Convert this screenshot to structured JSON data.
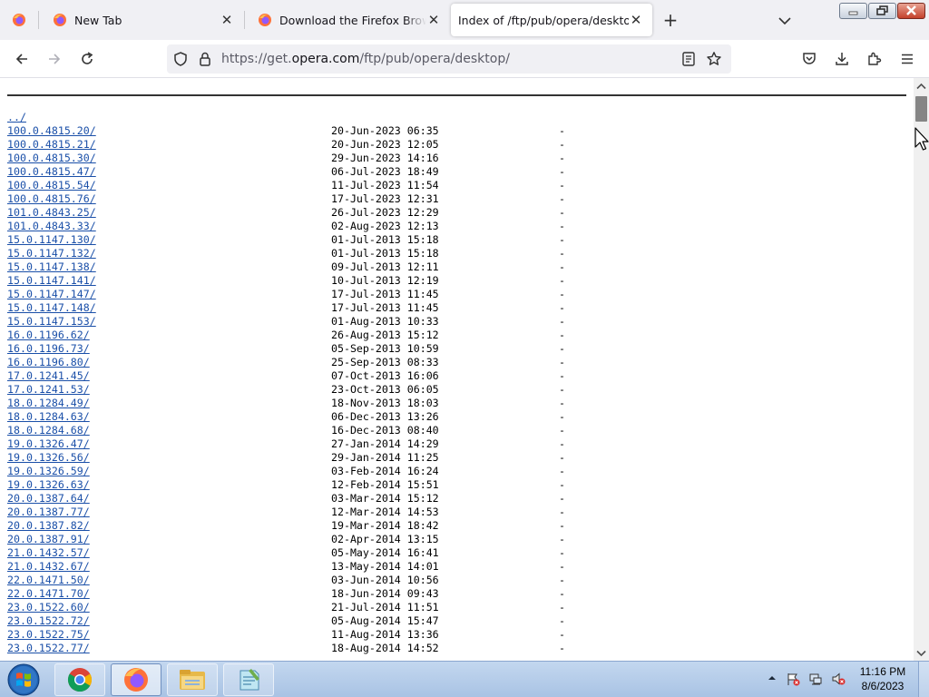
{
  "browser": {
    "tabs": [
      {
        "title": "New Tab",
        "active": false
      },
      {
        "title": "Download the Firefox Browser in English",
        "active": false
      },
      {
        "title": "Index of /ftp/pub/opera/desktop/",
        "active": true
      }
    ],
    "url": {
      "scheme": "https://get.",
      "host": "opera.com",
      "path": "/ftp/pub/opera/desktop/"
    }
  },
  "listing": {
    "parent": "../",
    "entries": [
      {
        "name": "100.0.4815.20/",
        "date": "20-Jun-2023 06:35",
        "size": "-"
      },
      {
        "name": "100.0.4815.21/",
        "date": "20-Jun-2023 12:05",
        "size": "-"
      },
      {
        "name": "100.0.4815.30/",
        "date": "29-Jun-2023 14:16",
        "size": "-"
      },
      {
        "name": "100.0.4815.47/",
        "date": "06-Jul-2023 18:49",
        "size": "-"
      },
      {
        "name": "100.0.4815.54/",
        "date": "11-Jul-2023 11:54",
        "size": "-"
      },
      {
        "name": "100.0.4815.76/",
        "date": "17-Jul-2023 12:31",
        "size": "-"
      },
      {
        "name": "101.0.4843.25/",
        "date": "26-Jul-2023 12:29",
        "size": "-"
      },
      {
        "name": "101.0.4843.33/",
        "date": "02-Aug-2023 12:13",
        "size": "-"
      },
      {
        "name": "15.0.1147.130/",
        "date": "01-Jul-2013 15:18",
        "size": "-"
      },
      {
        "name": "15.0.1147.132/",
        "date": "01-Jul-2013 15:18",
        "size": "-"
      },
      {
        "name": "15.0.1147.138/",
        "date": "09-Jul-2013 12:11",
        "size": "-"
      },
      {
        "name": "15.0.1147.141/",
        "date": "10-Jul-2013 12:19",
        "size": "-"
      },
      {
        "name": "15.0.1147.147/",
        "date": "17-Jul-2013 11:45",
        "size": "-"
      },
      {
        "name": "15.0.1147.148/",
        "date": "17-Jul-2013 11:45",
        "size": "-"
      },
      {
        "name": "15.0.1147.153/",
        "date": "01-Aug-2013 10:33",
        "size": "-"
      },
      {
        "name": "16.0.1196.62/",
        "date": "26-Aug-2013 15:12",
        "size": "-"
      },
      {
        "name": "16.0.1196.73/",
        "date": "05-Sep-2013 10:59",
        "size": "-"
      },
      {
        "name": "16.0.1196.80/",
        "date": "25-Sep-2013 08:33",
        "size": "-"
      },
      {
        "name": "17.0.1241.45/",
        "date": "07-Oct-2013 16:06",
        "size": "-"
      },
      {
        "name": "17.0.1241.53/",
        "date": "23-Oct-2013 06:05",
        "size": "-"
      },
      {
        "name": "18.0.1284.49/",
        "date": "18-Nov-2013 18:03",
        "size": "-"
      },
      {
        "name": "18.0.1284.63/",
        "date": "06-Dec-2013 13:26",
        "size": "-"
      },
      {
        "name": "18.0.1284.68/",
        "date": "16-Dec-2013 08:40",
        "size": "-"
      },
      {
        "name": "19.0.1326.47/",
        "date": "27-Jan-2014 14:29",
        "size": "-"
      },
      {
        "name": "19.0.1326.56/",
        "date": "29-Jan-2014 11:25",
        "size": "-"
      },
      {
        "name": "19.0.1326.59/",
        "date": "03-Feb-2014 16:24",
        "size": "-"
      },
      {
        "name": "19.0.1326.63/",
        "date": "12-Feb-2014 15:51",
        "size": "-"
      },
      {
        "name": "20.0.1387.64/",
        "date": "03-Mar-2014 15:12",
        "size": "-"
      },
      {
        "name": "20.0.1387.77/",
        "date": "12-Mar-2014 14:53",
        "size": "-"
      },
      {
        "name": "20.0.1387.82/",
        "date": "19-Mar-2014 18:42",
        "size": "-"
      },
      {
        "name": "20.0.1387.91/",
        "date": "02-Apr-2014 13:15",
        "size": "-"
      },
      {
        "name": "21.0.1432.57/",
        "date": "05-May-2014 16:41",
        "size": "-"
      },
      {
        "name": "21.0.1432.67/",
        "date": "13-May-2014 14:01",
        "size": "-"
      },
      {
        "name": "22.0.1471.50/",
        "date": "03-Jun-2014 10:56",
        "size": "-"
      },
      {
        "name": "22.0.1471.70/",
        "date": "18-Jun-2014 09:43",
        "size": "-"
      },
      {
        "name": "23.0.1522.60/",
        "date": "21-Jul-2014 11:51",
        "size": "-"
      },
      {
        "name": "23.0.1522.72/",
        "date": "05-Aug-2014 15:47",
        "size": "-"
      },
      {
        "name": "23.0.1522.75/",
        "date": "11-Aug-2014 13:36",
        "size": "-"
      },
      {
        "name": "23.0.1522.77/",
        "date": "18-Aug-2014 14:52",
        "size": "-"
      }
    ]
  },
  "taskbar": {
    "apps": [
      {
        "icon": "chrome-icon"
      },
      {
        "icon": "firefox-icon"
      },
      {
        "icon": "file-explorer-icon"
      },
      {
        "icon": "notepad-icon"
      }
    ],
    "clock": {
      "time": "11:16 PM",
      "date": "8/6/2023"
    }
  },
  "colors": {
    "link": "#1a4fa8",
    "tabstrip": "#f0f0f4",
    "close_button": "#c4412b"
  }
}
